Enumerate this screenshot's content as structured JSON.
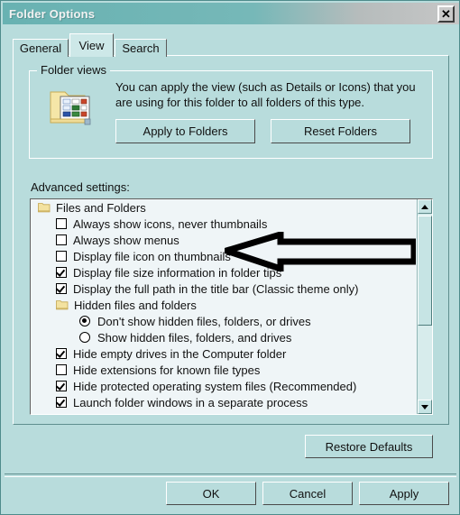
{
  "window": {
    "title": "Folder Options",
    "close_label": "✕",
    "colors": {
      "titlebar": "#6cb5b5",
      "dialog_bg": "#b8dcdc",
      "listbox_bg": "#eff5f7",
      "text": "#111111",
      "annotation": "#000000"
    }
  },
  "tabs": [
    {
      "label": "General",
      "active": false
    },
    {
      "label": "View",
      "active": true
    },
    {
      "label": "Search",
      "active": false
    }
  ],
  "folder_views": {
    "group_title": "Folder views",
    "icon_name": "folder-thumbnails-icon",
    "description": "You can apply the view (such as Details or Icons) that you are using for this folder to all folders of this type.",
    "apply_button": "Apply to Folders",
    "reset_button": "Reset Folders"
  },
  "advanced": {
    "label": "Advanced settings:",
    "items": [
      {
        "type": "group",
        "level": 0,
        "label": "Files and Folders"
      },
      {
        "type": "checkbox",
        "level": 1,
        "label": "Always show icons, never thumbnails",
        "checked": false
      },
      {
        "type": "checkbox",
        "level": 1,
        "label": "Always show menus",
        "checked": false
      },
      {
        "type": "checkbox",
        "level": 1,
        "label": "Display file icon on thumbnails",
        "checked": false
      },
      {
        "type": "checkbox",
        "level": 1,
        "label": "Display file size information in folder tips",
        "checked": true
      },
      {
        "type": "checkbox",
        "level": 1,
        "label": "Display the full path in the title bar (Classic theme only)",
        "checked": true
      },
      {
        "type": "group",
        "level": 1,
        "label": "Hidden files and folders"
      },
      {
        "type": "radio",
        "level": 2,
        "label": "Don't show hidden files, folders, or drives",
        "checked": true
      },
      {
        "type": "radio",
        "level": 2,
        "label": "Show hidden files, folders, and drives",
        "checked": false
      },
      {
        "type": "checkbox",
        "level": 1,
        "label": "Hide empty drives in the Computer folder",
        "checked": true
      },
      {
        "type": "checkbox",
        "level": 1,
        "label": "Hide extensions for known file types",
        "checked": false
      },
      {
        "type": "checkbox",
        "level": 1,
        "label": "Hide protected operating system files (Recommended)",
        "checked": true
      },
      {
        "type": "checkbox",
        "level": 1,
        "label": "Launch folder windows in a separate process",
        "checked": true
      }
    ],
    "scrollbar": {
      "up_icon": "scroll-up-arrow-icon",
      "down_icon": "scroll-down-arrow-icon",
      "thumb_name": "scroll-thumb"
    }
  },
  "restore_defaults_button": "Restore Defaults",
  "dialog_buttons": {
    "ok": "OK",
    "cancel": "Cancel",
    "apply": "Apply"
  },
  "annotation": {
    "name": "left-pointing-arrow-annotation",
    "points_at": "Display file icon on thumbnails"
  }
}
